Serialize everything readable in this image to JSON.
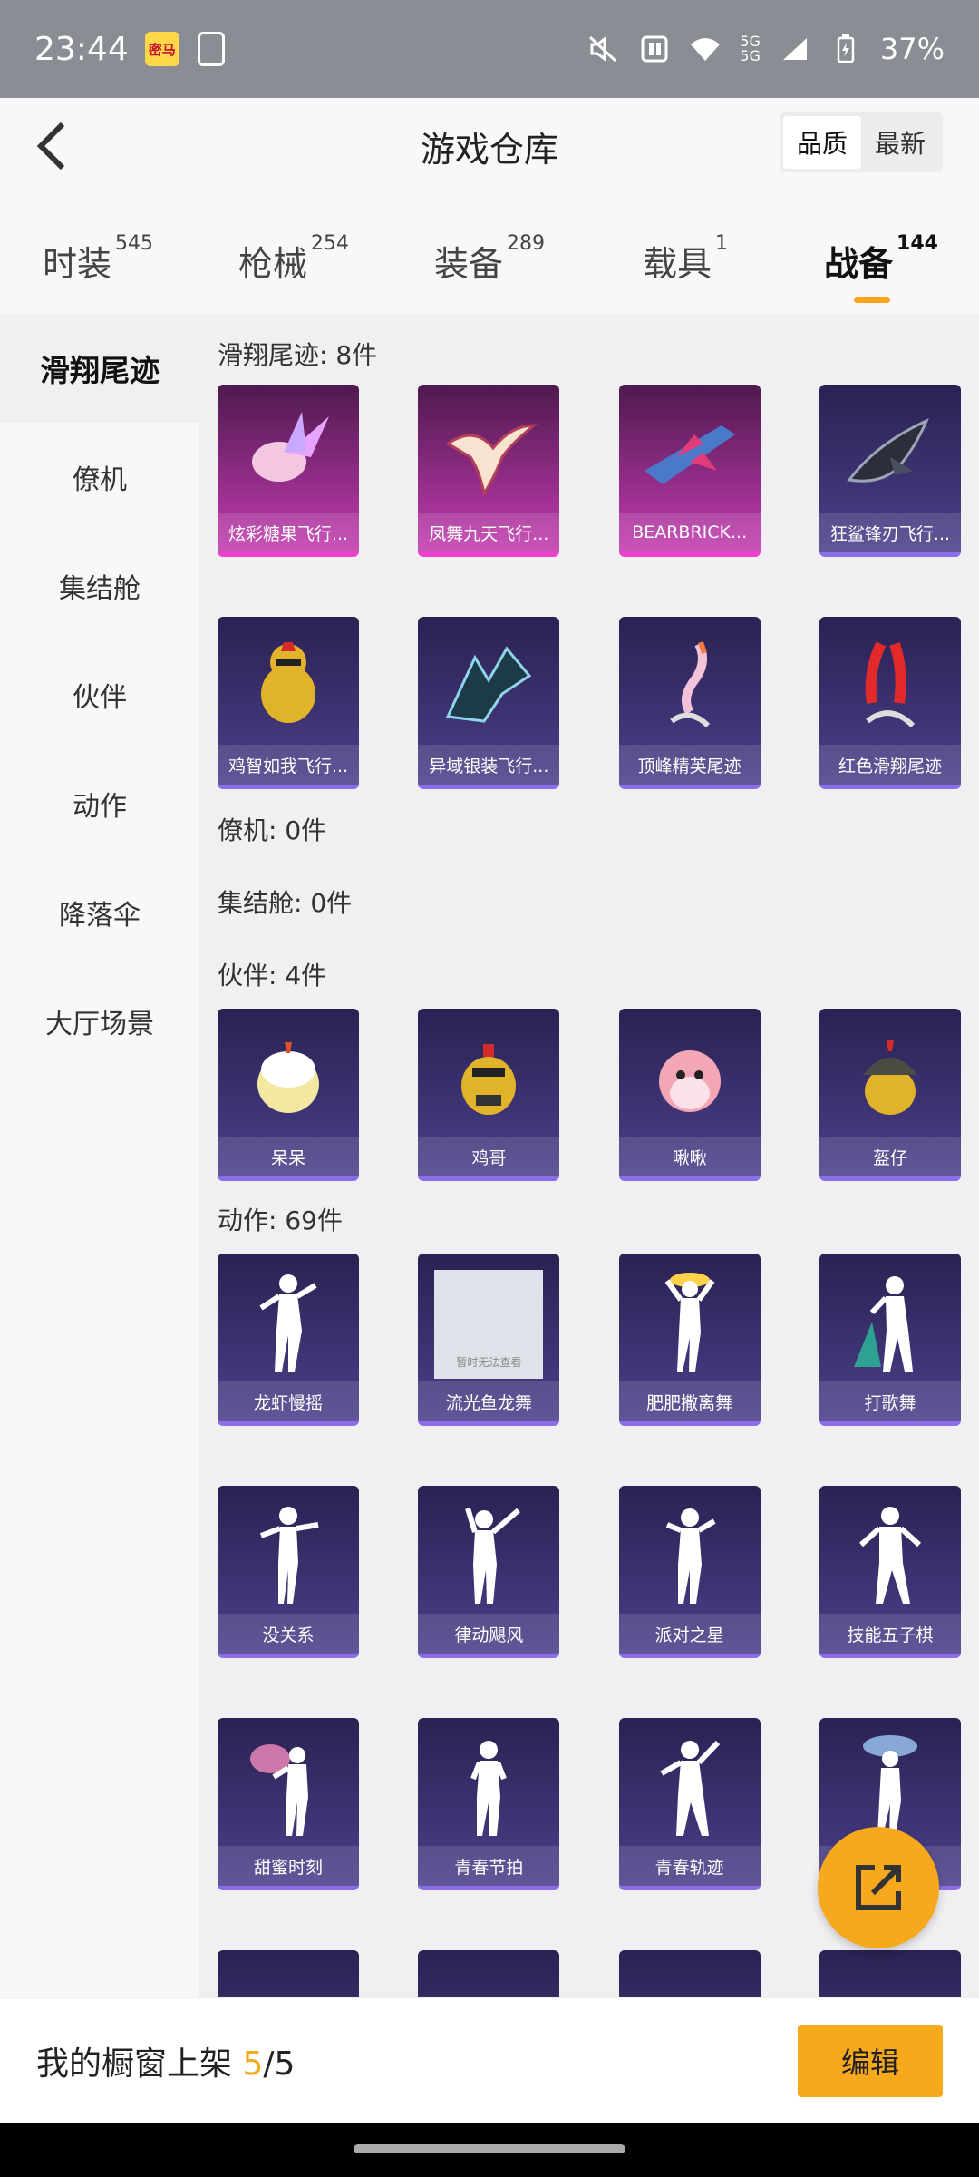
{
  "status_bar": {
    "time": "23:44",
    "app_icon_text": "密马",
    "battery": "37%",
    "network": "5G"
  },
  "header": {
    "title": "游戏仓库",
    "sort_options": [
      "品质",
      "最新"
    ],
    "sort_active": "品质"
  },
  "tabs": [
    {
      "label": "时装",
      "count": "545"
    },
    {
      "label": "枪械",
      "count": "254"
    },
    {
      "label": "装备",
      "count": "289"
    },
    {
      "label": "载具",
      "count": "1"
    },
    {
      "label": "战备",
      "count": "144"
    }
  ],
  "sidebar": {
    "items": [
      {
        "label": "滑翔尾迹"
      },
      {
        "label": "僚机"
      },
      {
        "label": "集结舱"
      },
      {
        "label": "伙伴"
      },
      {
        "label": "动作"
      },
      {
        "label": "降落伞"
      },
      {
        "label": "大厅场景"
      }
    ]
  },
  "sections": {
    "glide": {
      "title": "滑翔尾迹: 8件",
      "items": [
        {
          "name": "炫彩糖果飞行...",
          "icon": "candy-icon",
          "rarity": "pink"
        },
        {
          "name": "凤舞九天飞行...",
          "icon": "phoenix-icon",
          "rarity": "pink"
        },
        {
          "name": "BEARBRICK...",
          "icon": "jet-icon",
          "rarity": "pink"
        },
        {
          "name": "狂鲨锋刃飞行...",
          "icon": "shark-icon",
          "rarity": "purple"
        },
        {
          "name": "鸡智如我飞行...",
          "icon": "chicken-icon",
          "rarity": "purple"
        },
        {
          "name": "异域银装飞行...",
          "icon": "wing-icon",
          "rarity": "purple"
        },
        {
          "name": "顶峰精英尾迹",
          "icon": "trail-icon",
          "rarity": "purple"
        },
        {
          "name": "红色滑翔尾迹",
          "icon": "red-trail-icon",
          "rarity": "purple"
        }
      ]
    },
    "wingman": {
      "title": "僚机: 0件"
    },
    "pod": {
      "title": "集结舱: 0件"
    },
    "partner": {
      "title": "伙伴: 4件",
      "items": [
        {
          "name": "呆呆",
          "icon": "chick-icon"
        },
        {
          "name": "鸡哥",
          "icon": "cool-chicken-icon"
        },
        {
          "name": "啾啾",
          "icon": "pink-bird-icon"
        },
        {
          "name": "盔仔",
          "icon": "helmet-chick-icon"
        }
      ]
    },
    "emote": {
      "title": "动作: 69件",
      "placeholder_text": "暂时无法查看",
      "items": [
        {
          "name": "龙虾慢摇"
        },
        {
          "name": "流光鱼龙舞"
        },
        {
          "name": "肥肥撒离舞"
        },
        {
          "name": "打歌舞"
        },
        {
          "name": "没关系"
        },
        {
          "name": "律动飓风"
        },
        {
          "name": "派对之星"
        },
        {
          "name": "技能五子棋"
        },
        {
          "name": "甜蜜时刻"
        },
        {
          "name": "青春节拍"
        },
        {
          "name": "青春轨迹"
        },
        {
          "name": ""
        }
      ]
    }
  },
  "bottom_bar": {
    "label": "我的橱窗上架 ",
    "shown": "5",
    "total": "/5",
    "edit_label": "编辑"
  },
  "colors": {
    "accent": "#f7a91e",
    "card_purple": "#4a3f8a",
    "card_pink": "#c43bb0"
  }
}
